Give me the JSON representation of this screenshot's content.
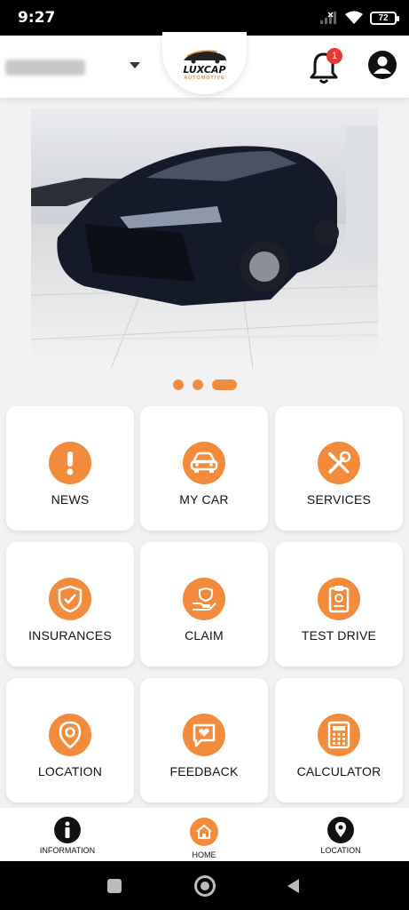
{
  "status_bar": {
    "time": "9:27",
    "battery": "72"
  },
  "header": {
    "logo": {
      "name": "LUXCAP",
      "tagline": "AUTOMOTIVE"
    },
    "notification_count": "1"
  },
  "carousel": {
    "slide_count": 3,
    "active_index": 2
  },
  "grid": [
    {
      "label": "NEWS",
      "icon": "exclamation-icon"
    },
    {
      "label": "MY CAR",
      "icon": "car-icon"
    },
    {
      "label": "SERVICES",
      "icon": "tools-icon"
    },
    {
      "label": "INSURANCES",
      "icon": "shield-check-icon"
    },
    {
      "label": "CLAIM",
      "icon": "hand-shield-icon"
    },
    {
      "label": "TEST DRIVE",
      "icon": "clipboard-icon"
    },
    {
      "label": "LOCATION",
      "icon": "location-pin-icon"
    },
    {
      "label": "FEEDBACK",
      "icon": "chat-heart-icon"
    },
    {
      "label": "CALCULATOR",
      "icon": "calculator-icon"
    }
  ],
  "bottom_nav": {
    "information": "INFORMATION",
    "home": "HOME",
    "location": "LOCATION"
  },
  "colors": {
    "accent": "#f28c3c",
    "badge": "#e53935"
  }
}
